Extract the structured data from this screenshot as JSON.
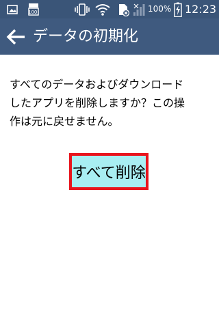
{
  "status_bar": {
    "icons": [
      "image-icon",
      "storage-100-icon",
      "vibrate-icon",
      "wifi-icon",
      "sd-card-error-icon",
      "signal-no-service-icon",
      "battery-charging-icon"
    ],
    "storage_label": "100",
    "battery_percent": "100%",
    "time": "12:23"
  },
  "action_bar": {
    "back_icon": "arrow-left-icon",
    "title": "データの初期化"
  },
  "message": {
    "lines": [
      "すべてのデータおよびダウンロード",
      "したアプリを削除しますか？この操",
      "作は元に戻せません。"
    ]
  },
  "delete_button": {
    "label": "すべて削除"
  },
  "colors": {
    "status_bar_bg": "#3a5578",
    "action_bar_bg": "#3f5a7f",
    "button_bg": "#a8eef2",
    "button_border": "#e8141c"
  }
}
